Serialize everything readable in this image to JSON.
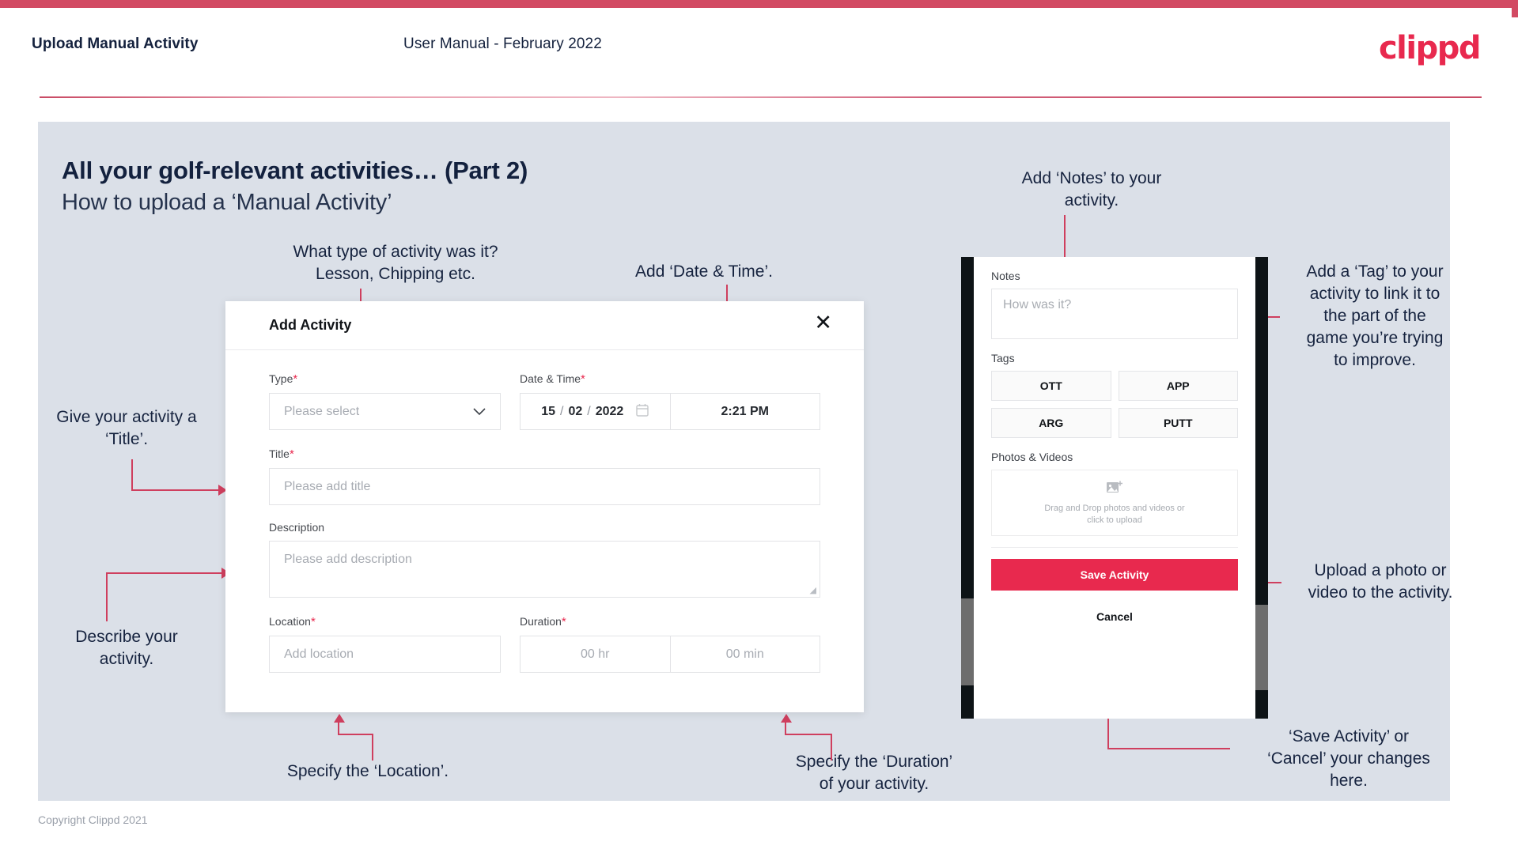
{
  "header": {
    "title": "Upload Manual Activity",
    "subtitle": "User Manual - February 2022",
    "logo": "clippd"
  },
  "slide": {
    "title": "All your golf-relevant activities… (Part 2)",
    "subtitle": "How to upload a ‘Manual Activity’",
    "copyright": "Copyright Clippd 2021"
  },
  "modal": {
    "title": "Add Activity",
    "close_icon": "✕",
    "fields": {
      "type": {
        "label": "Type",
        "required": "*",
        "placeholder": "Please select",
        "chevron": "⌄"
      },
      "datetime": {
        "label": "Date & Time",
        "required": "*",
        "day": "15",
        "month": "02",
        "year": "2022",
        "sep": "/",
        "calendar_icon": "calendar",
        "time": "2:21 PM"
      },
      "title": {
        "label": "Title",
        "required": "*",
        "placeholder": "Please add title"
      },
      "description": {
        "label": "Description",
        "required": "",
        "placeholder": "Please add description"
      },
      "location": {
        "label": "Location",
        "required": "*",
        "placeholder": "Add location"
      },
      "duration": {
        "label": "Duration",
        "required": "*",
        "hours": "00 hr",
        "minutes": "00 min"
      }
    }
  },
  "phone": {
    "notes": {
      "label": "Notes",
      "placeholder": "How was it?"
    },
    "tags": {
      "label": "Tags",
      "items": [
        "OTT",
        "APP",
        "ARG",
        "PUTT"
      ]
    },
    "photos": {
      "label": "Photos & Videos",
      "icon": "add-image-icon",
      "line1": "Drag and Drop photos and videos or",
      "line2": "click to upload"
    },
    "save_label": "Save Activity",
    "cancel_label": "Cancel"
  },
  "annotations": {
    "type": "What type of activity was it?\nLesson, Chipping etc.",
    "datetime": "Add ‘Date & Time’.",
    "title": "Give your activity a\n‘Title’.",
    "description": "Describe your\nactivity.",
    "location": "Specify the ‘Location’.",
    "duration": "Specify the ‘Duration’\nof your activity.",
    "notes": "Add ‘Notes’ to your\nactivity.",
    "tags": "Add a ‘Tag’ to your\nactivity to link it to\nthe part of the\ngame you’re trying\nto improve.",
    "upload": "Upload a photo or\nvideo to the activity.",
    "save": "‘Save Activity’ or\n‘Cancel’ your changes\nhere."
  },
  "colors": {
    "accent": "#e8294e",
    "annotation_line": "#cf3f5e",
    "canvas": "#dbe0e8",
    "text_dark": "#16233f"
  }
}
